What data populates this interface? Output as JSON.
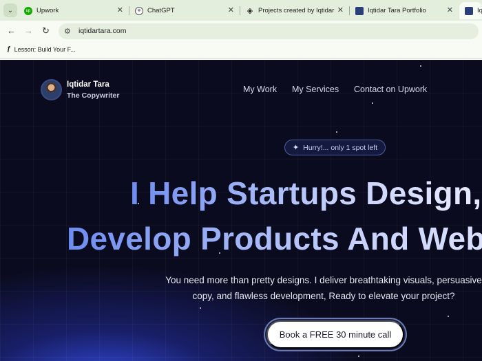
{
  "browser": {
    "tabs": [
      {
        "title": "Upwork",
        "favicon": "upwork-logo-icon"
      },
      {
        "title": "ChatGPT",
        "favicon": "chatgpt-logo-icon"
      },
      {
        "title": "Projects created by Iqtidar H",
        "favicon": "figma-logo-icon"
      },
      {
        "title": "Iqtidar Tara Portfolio",
        "favicon": "portfolio-favicon-icon"
      },
      {
        "title": "Iq",
        "favicon": "portfolio-favicon-icon"
      }
    ],
    "url": "iqtidartara.com",
    "bookmarks": [
      {
        "label": "Lesson: Build Your F..."
      }
    ]
  },
  "site": {
    "brand": {
      "name": "Iqtidar Tara",
      "tagline": "The Copywriter"
    },
    "nav": [
      {
        "label": "My Work"
      },
      {
        "label": "My Services"
      },
      {
        "label": "Contact on Upwork"
      }
    ],
    "badge": "Hurry!... only 1 spot left",
    "hero": {
      "line1": "I Help Startups Design,",
      "line2": "Develop Products And Websites"
    },
    "subtext": {
      "line1": "You need more than pretty designs. I deliver breathtaking visuals, persuasive",
      "line2": "copy, and flawless development, Ready to elevate your project?"
    },
    "cta": "Book a FREE 30 minute call"
  },
  "colors": {
    "chrome_tabstrip": "#e3eedc",
    "chrome_toolbar": "#f7fbf4",
    "site_background": "#0b0b1f",
    "hero_gradient_start": "#6d8cf0",
    "accent_glow": "#3a56ff"
  }
}
